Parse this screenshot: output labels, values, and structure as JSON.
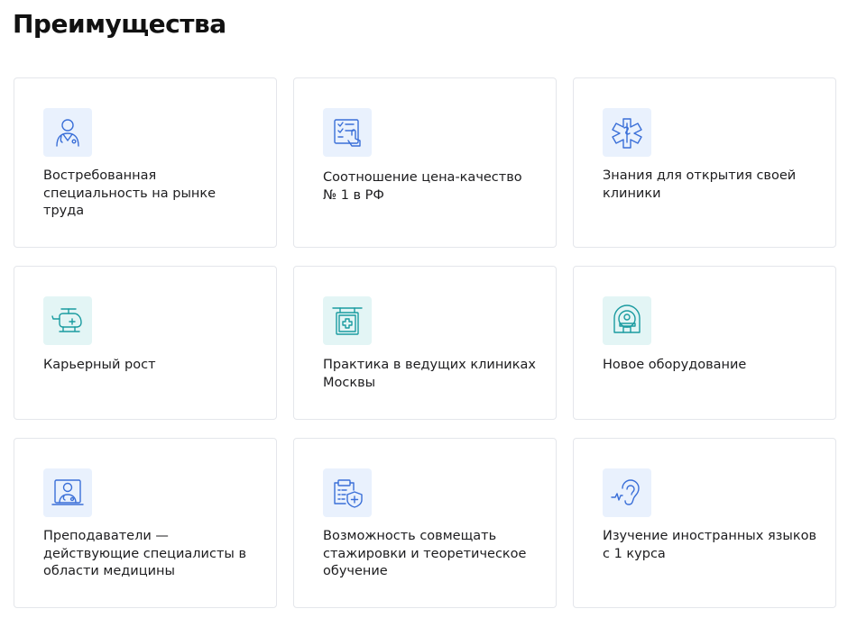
{
  "page": {
    "title": "Преимущества"
  },
  "colors": {
    "accent_blue": "#3a6fd8",
    "accent_teal": "#1a9ba0",
    "tile_blue": "#e9f1fd",
    "tile_teal": "#e3f5f5",
    "border": "#e4e6eb"
  },
  "cards": [
    {
      "icon": "doctor-icon",
      "text": "Востребованная специальность на рынке труда"
    },
    {
      "icon": "touch-screen-icon",
      "text": "Соотношение цена-качество № 1 в РФ"
    },
    {
      "icon": "medical-star-icon",
      "text": "Знания для открытия своей клиники"
    },
    {
      "icon": "helicopter-icon",
      "text": "Карьерный рост"
    },
    {
      "icon": "clinic-sign-icon",
      "text": "Практика в ведущих клиниках Москвы"
    },
    {
      "icon": "mri-scanner-icon",
      "text": "Новое оборудование"
    },
    {
      "icon": "online-doctor-icon",
      "text": "Преподаватели — действующие специалисты в области медицины"
    },
    {
      "icon": "clipboard-shield-icon",
      "text": "Возможность совмещать стажировки и теоретическое обучение"
    },
    {
      "icon": "ear-icon",
      "text": "Изучение иностранных языков с 1 курса"
    }
  ]
}
